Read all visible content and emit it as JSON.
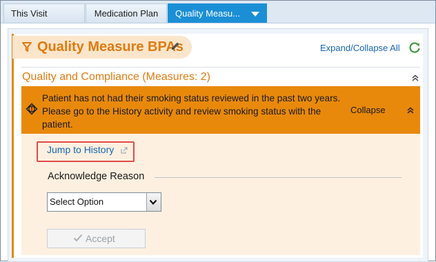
{
  "tabs": {
    "visit": "This Visit",
    "medication": "Medication Plan",
    "quality": "Quality Measu..."
  },
  "header": {
    "title": "Quality Measure BPAs",
    "expand_collapse": "Expand/Collapse All"
  },
  "group": {
    "title": "Quality and Compliance (Measures: 2)"
  },
  "alert": {
    "message": "Patient has not had their smoking status reviewed in the past two years. Please go to the History activity and review smoking status with the patient.",
    "collapse": "Collapse"
  },
  "actions": {
    "jump_link": "Jump to History",
    "acknowledge_label": "Acknowledge Reason",
    "select_value": "Select Option",
    "accept_label": "Accept"
  },
  "colors": {
    "accent_orange": "#e8890b",
    "tab_active": "#1b8fd6",
    "link_blue": "#1666b6",
    "highlight_red": "#e04a4a"
  },
  "icons": [
    "funnel-icon",
    "pencil-icon",
    "refresh-icon",
    "double-chevron-up-icon",
    "warning-icon",
    "external-link-icon",
    "chevron-down-icon",
    "check-icon"
  ]
}
